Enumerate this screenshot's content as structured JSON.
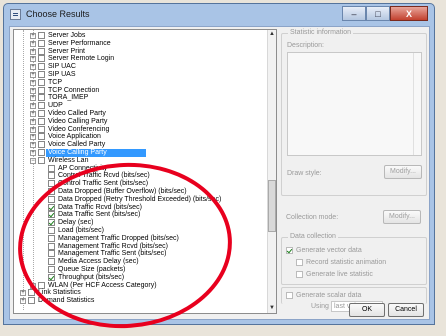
{
  "window": {
    "title": "Choose Results",
    "controls": {
      "minimize": "–",
      "maximize": "□",
      "close": "X"
    }
  },
  "tree": {
    "rows": [
      {
        "label": "Server Jobs",
        "kind": "node",
        "pm": "+",
        "sel": false,
        "checked": false
      },
      {
        "label": "Server Performance",
        "kind": "node",
        "pm": "+",
        "sel": false,
        "checked": false
      },
      {
        "label": "Server Print",
        "kind": "node",
        "pm": "+",
        "sel": false,
        "checked": false
      },
      {
        "label": "Server Remote Login",
        "kind": "node",
        "pm": "+",
        "sel": false,
        "checked": false
      },
      {
        "label": "SIP UAC",
        "kind": "node",
        "pm": "+",
        "sel": false,
        "checked": false
      },
      {
        "label": "SIP UAS",
        "kind": "node",
        "pm": "+",
        "sel": false,
        "checked": false
      },
      {
        "label": "TCP",
        "kind": "node",
        "pm": "+",
        "sel": false,
        "checked": false
      },
      {
        "label": "TCP Connection",
        "kind": "node",
        "pm": "+",
        "sel": false,
        "checked": false
      },
      {
        "label": "TORA_IMEP",
        "kind": "node",
        "pm": "+",
        "sel": false,
        "checked": false
      },
      {
        "label": "UDP",
        "kind": "node",
        "pm": "+",
        "sel": false,
        "checked": false
      },
      {
        "label": "Video Called Party",
        "kind": "node",
        "pm": "+",
        "sel": false,
        "checked": false
      },
      {
        "label": "Video Calling Party",
        "kind": "node",
        "pm": "+",
        "sel": false,
        "checked": false
      },
      {
        "label": "Video Conferencing",
        "kind": "node",
        "pm": "+",
        "sel": false,
        "checked": false
      },
      {
        "label": "Voice Application",
        "kind": "node",
        "pm": "+",
        "sel": false,
        "checked": false
      },
      {
        "label": "Voice Called Party",
        "kind": "node",
        "pm": "+",
        "sel": false,
        "checked": false
      },
      {
        "label": "Voice Calling Party",
        "kind": "node",
        "pm": "+",
        "sel": true,
        "checked": false
      },
      {
        "label": "Wireless Lan",
        "kind": "node",
        "pm": "−",
        "sel": false,
        "checked": false
      },
      {
        "label": "AP Connectivity",
        "kind": "leaf",
        "sel": false,
        "checked": false
      },
      {
        "label": "Control Traffic Rcvd (bits/sec)",
        "kind": "leaf",
        "sel": false,
        "checked": false
      },
      {
        "label": "Control Traffic Sent (bits/sec)",
        "kind": "leaf",
        "sel": false,
        "checked": false
      },
      {
        "label": "Data Dropped (Buffer Overflow) (bits/sec)",
        "kind": "leaf",
        "sel": false,
        "checked": false
      },
      {
        "label": "Data Dropped (Retry Threshold Exceeded) (bits/sec)",
        "kind": "leaf",
        "sel": false,
        "checked": false
      },
      {
        "label": "Data Traffic Rcvd (bits/sec)",
        "kind": "leaf",
        "sel": false,
        "checked": true
      },
      {
        "label": "Data Traffic Sent (bits/sec)",
        "kind": "leaf",
        "sel": false,
        "checked": true
      },
      {
        "label": "Delay (sec)",
        "kind": "leaf",
        "sel": false,
        "checked": true
      },
      {
        "label": "Load (bits/sec)",
        "kind": "leaf",
        "sel": false,
        "checked": false
      },
      {
        "label": "Management Traffic Dropped (bits/sec)",
        "kind": "leaf",
        "sel": false,
        "checked": false
      },
      {
        "label": "Management Traffic Rcvd (bits/sec)",
        "kind": "leaf",
        "sel": false,
        "checked": false
      },
      {
        "label": "Management Traffic Sent (bits/sec)",
        "kind": "leaf",
        "sel": false,
        "checked": false
      },
      {
        "label": "Media Access Delay (sec)",
        "kind": "leaf",
        "sel": false,
        "checked": false
      },
      {
        "label": "Queue Size (packets)",
        "kind": "leaf",
        "sel": false,
        "checked": false
      },
      {
        "label": "Throughput (bits/sec)",
        "kind": "leaf",
        "sel": false,
        "checked": true
      },
      {
        "label": "WLAN (Per HCF Access Category)",
        "kind": "node",
        "pm": "+",
        "sel": false,
        "checked": false
      },
      {
        "label": "Link Statistics",
        "kind": "root",
        "pm": "+",
        "sel": false,
        "checked": false
      },
      {
        "label": "Demand Statistics",
        "kind": "root",
        "pm": "+",
        "sel": false,
        "checked": false
      }
    ]
  },
  "statistic_info": {
    "group_label": "Statistic information",
    "description_label": "Description:",
    "draw_style_label": "Draw style:",
    "draw_style_button": "Modify...",
    "collection_mode_label": "Collection mode:",
    "collection_mode_button": "Modify..."
  },
  "data_collection": {
    "group_label": "Data collection",
    "generate_vector": "Generate vector data",
    "record_animation": "Record statistic animation",
    "generate_live": "Generate live statistic",
    "generate_scalar": "Generate scalar data",
    "using_label": "Using",
    "using_value": "last value"
  },
  "buttons": {
    "ok": "OK",
    "cancel": "Cancel"
  },
  "colors": {
    "selection": "#3399ff",
    "annotation_circle": "#e8001e",
    "check": "#1a7f1a"
  }
}
